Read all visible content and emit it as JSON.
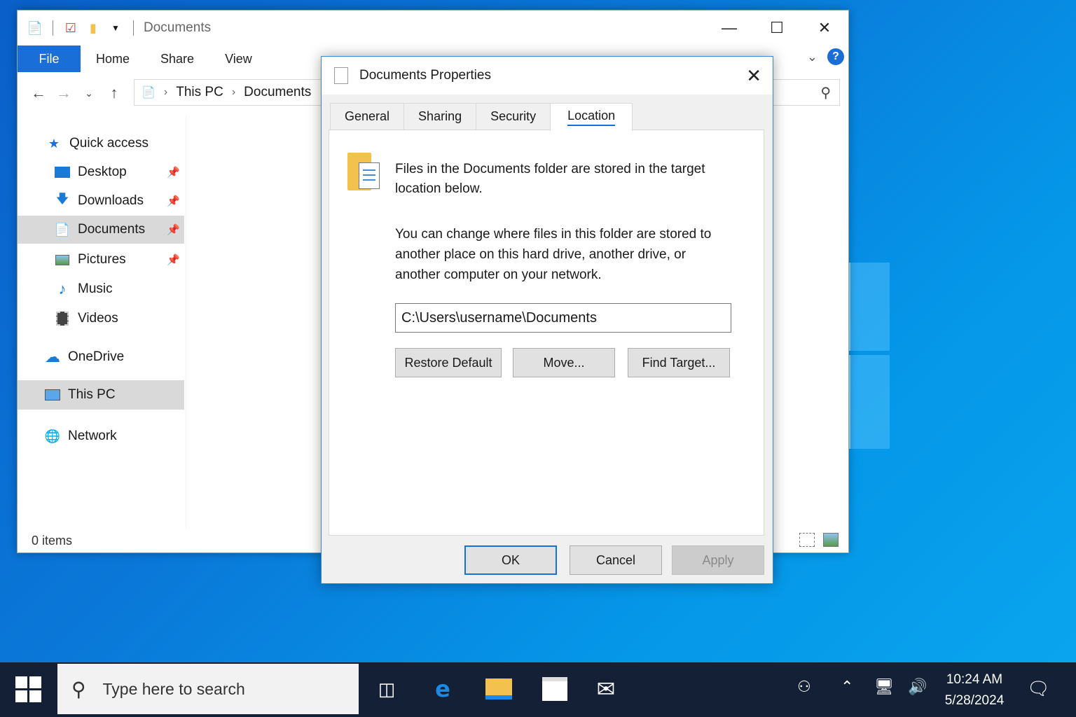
{
  "explorer": {
    "title": "Documents",
    "ribbon": {
      "file": "File",
      "tabs": [
        "Home",
        "Share",
        "View"
      ]
    },
    "address": {
      "parts": [
        "This PC",
        "Documents"
      ]
    },
    "nav": {
      "quick_access": "Quick access",
      "desktop": "Desktop",
      "downloads": "Downloads",
      "documents": "Documents",
      "pictures": "Pictures",
      "music": "Music",
      "videos": "Videos",
      "onedrive": "OneDrive",
      "this_pc": "This PC",
      "network": "Network"
    },
    "status": "0 items"
  },
  "dialog": {
    "title": "Documents Properties",
    "tabs": [
      "General",
      "Sharing",
      "Security",
      "Location"
    ],
    "active_tab": "Location",
    "desc1": "Files in the Documents folder are stored in the target location below.",
    "desc2": "You can change where files in this folder are stored to another place on this hard drive, another drive, or another computer on your network.",
    "path": "C:\\Users\\username\\Documents",
    "restore_default": "Restore Default",
    "move": "Move...",
    "find_target": "Find Target...",
    "ok": "OK",
    "cancel": "Cancel",
    "apply": "Apply"
  },
  "taskbar": {
    "search_placeholder": "Type here to search",
    "time": "10:24 AM",
    "date": "5/28/2024"
  },
  "colors": {
    "accent": "#1a6ed8",
    "taskbar": "#142035",
    "desktop": "#0a78d8"
  }
}
